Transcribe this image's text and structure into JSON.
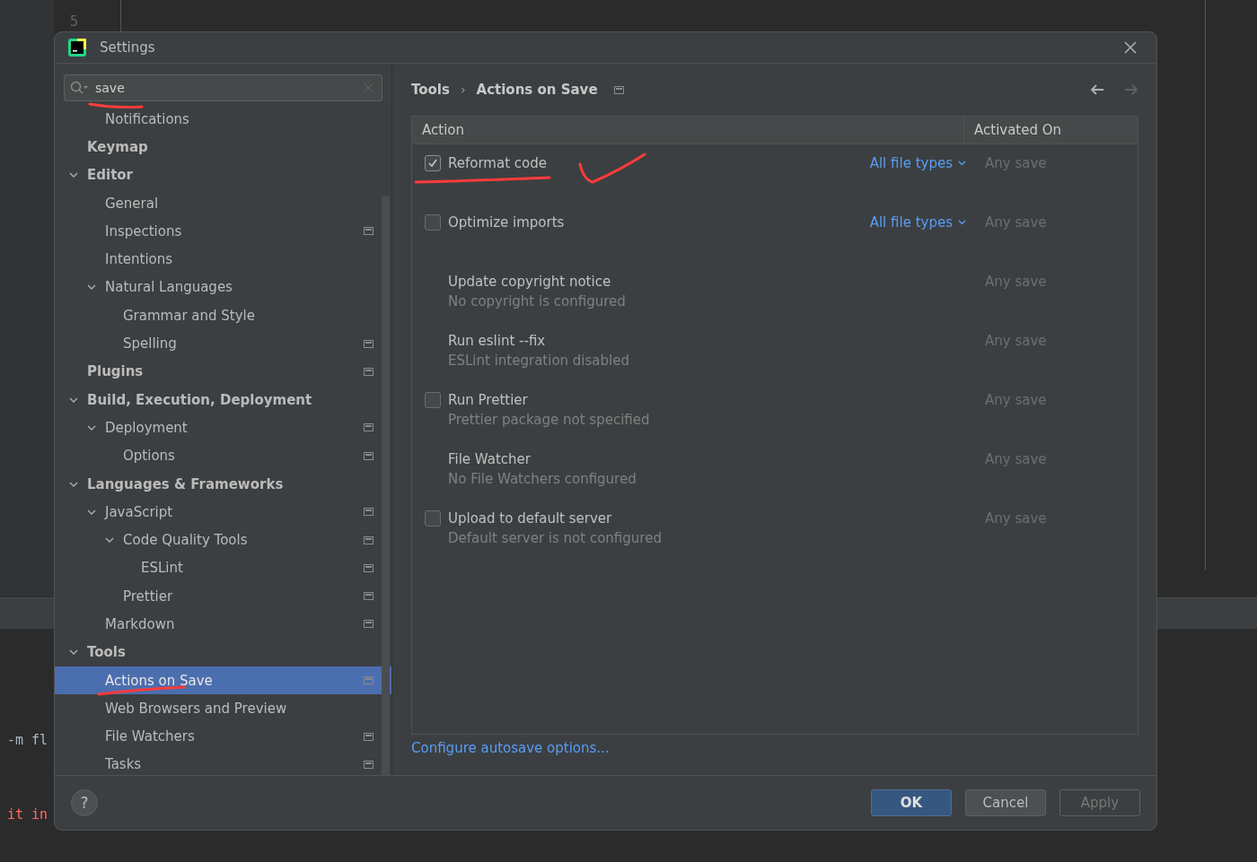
{
  "background_editor": {
    "line_number": "5",
    "lines": [
      {
        "text": "-m fl",
        "kind": "plain"
      },
      {
        "text": "it in",
        "kind": "error"
      }
    ]
  },
  "window": {
    "title": "Settings"
  },
  "search": {
    "value": "save"
  },
  "sidebar": {
    "items": [
      {
        "children": [
          {
            "label": "Notifications",
            "selected": false
          }
        ]
      },
      {
        "label": "Keymap",
        "selected": false
      },
      {
        "label": "Editor",
        "expanded": true,
        "selected": false,
        "children": [
          {
            "label": "General",
            "selected": false
          },
          {
            "label": "Inspections",
            "scoped": true,
            "selected": false
          },
          {
            "label": "Intentions",
            "selected": false
          },
          {
            "label": "Natural Languages",
            "expanded": true,
            "selected": false,
            "children": [
              {
                "label": "Grammar and Style",
                "selected": false
              },
              {
                "label": "Spelling",
                "scoped": true,
                "selected": false
              }
            ]
          }
        ]
      },
      {
        "label": "Plugins",
        "scoped": true,
        "selected": false
      },
      {
        "label": "Build, Execution, Deployment",
        "expanded": true,
        "selected": false,
        "children": [
          {
            "label": "Deployment",
            "expanded": true,
            "scoped": true,
            "selected": false,
            "children": [
              {
                "label": "Options",
                "scoped": true,
                "selected": false
              }
            ]
          }
        ]
      },
      {
        "label": "Languages & Frameworks",
        "expanded": true,
        "selected": false,
        "children": [
          {
            "label": "JavaScript",
            "expanded": true,
            "scoped": true,
            "selected": false,
            "children": [
              {
                "label": "Code Quality Tools",
                "expanded": true,
                "scoped": true,
                "selected": false,
                "children": [
                  {
                    "label": "ESLint",
                    "scoped": true,
                    "selected": false
                  }
                ]
              },
              {
                "label": "Prettier",
                "scoped": true,
                "selected": false
              }
            ]
          },
          {
            "label": "Markdown",
            "scoped": true,
            "selected": false
          }
        ]
      },
      {
        "label": "Tools",
        "expanded": true,
        "selected": false,
        "children": [
          {
            "label": "Actions on Save",
            "scoped": true,
            "selected": true
          },
          {
            "label": "Web Browsers and Preview",
            "selected": false
          },
          {
            "label": "File Watchers",
            "scoped": true,
            "selected": false
          },
          {
            "label": "Tasks",
            "scoped": true,
            "selected": false
          }
        ]
      }
    ]
  },
  "breadcrumb": {
    "items": [
      "Tools",
      "Actions on Save"
    ],
    "separator": "›"
  },
  "table": {
    "columns": [
      "Action",
      "Activated On"
    ],
    "rows": [
      {
        "kind": "checkbox",
        "name": "Reformat code",
        "checked": true,
        "file_types": "All file types",
        "activated_on": "Any save"
      },
      {
        "kind": "checkbox",
        "name": "Optimize imports",
        "checked": false,
        "file_types": "All file types",
        "activated_on": "Any save"
      },
      {
        "kind": "plain",
        "name": "Update copyright notice",
        "note": "No copyright is configured",
        "activated_on": "Any save"
      },
      {
        "kind": "plain",
        "name": "Run eslint --fix",
        "note": "ESLint integration disabled",
        "activated_on": "Any save"
      },
      {
        "kind": "checkbox",
        "name": "Run Prettier",
        "checked": false,
        "note": "Prettier package not specified",
        "activated_on": "Any save"
      },
      {
        "kind": "plain",
        "name": "File Watcher",
        "note": "No File Watchers configured",
        "activated_on": "Any save"
      },
      {
        "kind": "checkbox",
        "name": "Upload to default server",
        "checked": false,
        "note": "Default server is not configured",
        "activated_on": "Any save"
      }
    ]
  },
  "link": "Configure autosave options...",
  "help": "?",
  "buttons": [
    {
      "label": "OK",
      "kind": "default"
    },
    {
      "label": "Cancel",
      "kind": "normal"
    },
    {
      "label": "Apply",
      "kind": "disabled"
    }
  ]
}
